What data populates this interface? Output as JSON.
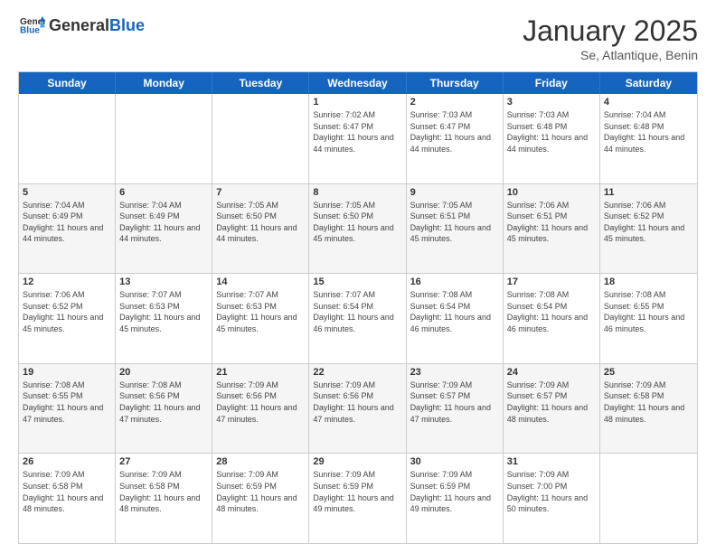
{
  "header": {
    "logo_general": "General",
    "logo_blue": "Blue",
    "month_title": "January 2025",
    "location": "Se, Atlantique, Benin"
  },
  "weekdays": [
    "Sunday",
    "Monday",
    "Tuesday",
    "Wednesday",
    "Thursday",
    "Friday",
    "Saturday"
  ],
  "rows": [
    [
      {
        "day": "",
        "info": ""
      },
      {
        "day": "",
        "info": ""
      },
      {
        "day": "",
        "info": ""
      },
      {
        "day": "1",
        "info": "Sunrise: 7:02 AM\nSunset: 6:47 PM\nDaylight: 11 hours and 44 minutes."
      },
      {
        "day": "2",
        "info": "Sunrise: 7:03 AM\nSunset: 6:47 PM\nDaylight: 11 hours and 44 minutes."
      },
      {
        "day": "3",
        "info": "Sunrise: 7:03 AM\nSunset: 6:48 PM\nDaylight: 11 hours and 44 minutes."
      },
      {
        "day": "4",
        "info": "Sunrise: 7:04 AM\nSunset: 6:48 PM\nDaylight: 11 hours and 44 minutes."
      }
    ],
    [
      {
        "day": "5",
        "info": "Sunrise: 7:04 AM\nSunset: 6:49 PM\nDaylight: 11 hours and 44 minutes."
      },
      {
        "day": "6",
        "info": "Sunrise: 7:04 AM\nSunset: 6:49 PM\nDaylight: 11 hours and 44 minutes."
      },
      {
        "day": "7",
        "info": "Sunrise: 7:05 AM\nSunset: 6:50 PM\nDaylight: 11 hours and 44 minutes."
      },
      {
        "day": "8",
        "info": "Sunrise: 7:05 AM\nSunset: 6:50 PM\nDaylight: 11 hours and 45 minutes."
      },
      {
        "day": "9",
        "info": "Sunrise: 7:05 AM\nSunset: 6:51 PM\nDaylight: 11 hours and 45 minutes."
      },
      {
        "day": "10",
        "info": "Sunrise: 7:06 AM\nSunset: 6:51 PM\nDaylight: 11 hours and 45 minutes."
      },
      {
        "day": "11",
        "info": "Sunrise: 7:06 AM\nSunset: 6:52 PM\nDaylight: 11 hours and 45 minutes."
      }
    ],
    [
      {
        "day": "12",
        "info": "Sunrise: 7:06 AM\nSunset: 6:52 PM\nDaylight: 11 hours and 45 minutes."
      },
      {
        "day": "13",
        "info": "Sunrise: 7:07 AM\nSunset: 6:53 PM\nDaylight: 11 hours and 45 minutes."
      },
      {
        "day": "14",
        "info": "Sunrise: 7:07 AM\nSunset: 6:53 PM\nDaylight: 11 hours and 45 minutes."
      },
      {
        "day": "15",
        "info": "Sunrise: 7:07 AM\nSunset: 6:54 PM\nDaylight: 11 hours and 46 minutes."
      },
      {
        "day": "16",
        "info": "Sunrise: 7:08 AM\nSunset: 6:54 PM\nDaylight: 11 hours and 46 minutes."
      },
      {
        "day": "17",
        "info": "Sunrise: 7:08 AM\nSunset: 6:54 PM\nDaylight: 11 hours and 46 minutes."
      },
      {
        "day": "18",
        "info": "Sunrise: 7:08 AM\nSunset: 6:55 PM\nDaylight: 11 hours and 46 minutes."
      }
    ],
    [
      {
        "day": "19",
        "info": "Sunrise: 7:08 AM\nSunset: 6:55 PM\nDaylight: 11 hours and 47 minutes."
      },
      {
        "day": "20",
        "info": "Sunrise: 7:08 AM\nSunset: 6:56 PM\nDaylight: 11 hours and 47 minutes."
      },
      {
        "day": "21",
        "info": "Sunrise: 7:09 AM\nSunset: 6:56 PM\nDaylight: 11 hours and 47 minutes."
      },
      {
        "day": "22",
        "info": "Sunrise: 7:09 AM\nSunset: 6:56 PM\nDaylight: 11 hours and 47 minutes."
      },
      {
        "day": "23",
        "info": "Sunrise: 7:09 AM\nSunset: 6:57 PM\nDaylight: 11 hours and 47 minutes."
      },
      {
        "day": "24",
        "info": "Sunrise: 7:09 AM\nSunset: 6:57 PM\nDaylight: 11 hours and 48 minutes."
      },
      {
        "day": "25",
        "info": "Sunrise: 7:09 AM\nSunset: 6:58 PM\nDaylight: 11 hours and 48 minutes."
      }
    ],
    [
      {
        "day": "26",
        "info": "Sunrise: 7:09 AM\nSunset: 6:58 PM\nDaylight: 11 hours and 48 minutes."
      },
      {
        "day": "27",
        "info": "Sunrise: 7:09 AM\nSunset: 6:58 PM\nDaylight: 11 hours and 48 minutes."
      },
      {
        "day": "28",
        "info": "Sunrise: 7:09 AM\nSunset: 6:59 PM\nDaylight: 11 hours and 48 minutes."
      },
      {
        "day": "29",
        "info": "Sunrise: 7:09 AM\nSunset: 6:59 PM\nDaylight: 11 hours and 49 minutes."
      },
      {
        "day": "30",
        "info": "Sunrise: 7:09 AM\nSunset: 6:59 PM\nDaylight: 11 hours and 49 minutes."
      },
      {
        "day": "31",
        "info": "Sunrise: 7:09 AM\nSunset: 7:00 PM\nDaylight: 11 hours and 50 minutes."
      },
      {
        "day": "",
        "info": ""
      }
    ]
  ]
}
